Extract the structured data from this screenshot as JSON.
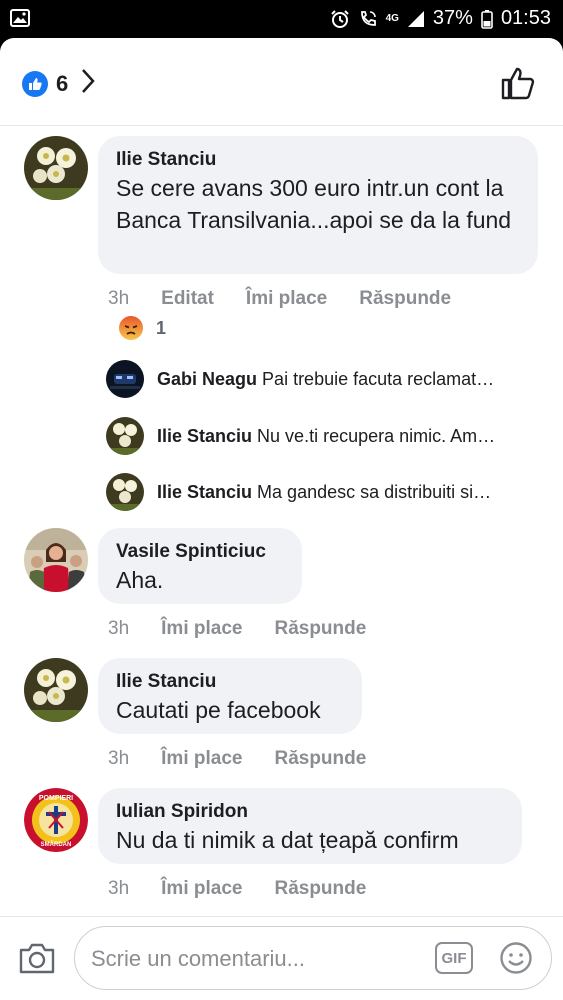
{
  "status_bar": {
    "network": "4G",
    "battery": "37%",
    "time": "01:53"
  },
  "header": {
    "reaction_count": "6"
  },
  "comments": [
    {
      "author": "Ilie Stanciu",
      "text": "Se cere avans 300 euro intr.un cont la Banca Transilvania...apoi se da la fund",
      "time": "3h",
      "edited": "Editat",
      "like": "Îmi place",
      "reply": "Răspunde",
      "reaction_count": "1",
      "replies": [
        {
          "author": "Gabi Neagu",
          "text": "Pai trebuie facuta reclamat…"
        },
        {
          "author": "Ilie Stanciu",
          "text": "Nu ve.ti recupera nimic. Am…"
        },
        {
          "author": "Ilie Stanciu",
          "text": "Ma gandesc sa distribuiti si…"
        }
      ]
    },
    {
      "author": "Vasile Spinticiuc",
      "text": "Aha.",
      "time": "3h",
      "like": "Îmi place",
      "reply": "Răspunde"
    },
    {
      "author": "Ilie Stanciu",
      "text": "Cautati pe facebook",
      "time": "3h",
      "like": "Îmi place",
      "reply": "Răspunde"
    },
    {
      "author": "Iulian Spiridon",
      "text": "Nu da ti nimik a dat țeapă  confirm",
      "time": "3h",
      "like": "Îmi place",
      "reply": "Răspunde",
      "avatar_badge_top": "POMPIERI",
      "avatar_badge_bottom": "SMÂRDAN"
    }
  ],
  "composer": {
    "placeholder": "Scrie un comentariu...",
    "gif_label": "GIF"
  },
  "colors": {
    "accent": "#1877f2",
    "bubble": "#f0f2f5",
    "muted": "#8a8d91",
    "text": "#1c1e21"
  }
}
